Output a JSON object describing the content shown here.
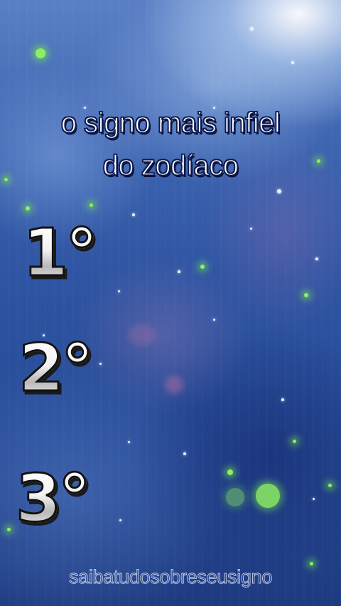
{
  "overlay": {
    "title_line1": "o signo mais infiel",
    "title_line2": "do zodíaco"
  },
  "ranking": [
    {
      "label": "1°"
    },
    {
      "label": "2°"
    },
    {
      "label": "3°"
    }
  ],
  "watermark": "saibatudosobreseusigno",
  "colors": {
    "title_fill": "#ffffff",
    "title_outline": "#0e1a4e",
    "background_top": "#5a7fc4",
    "background_bottom": "#1e3a80",
    "bokeh": "#8cf060"
  }
}
